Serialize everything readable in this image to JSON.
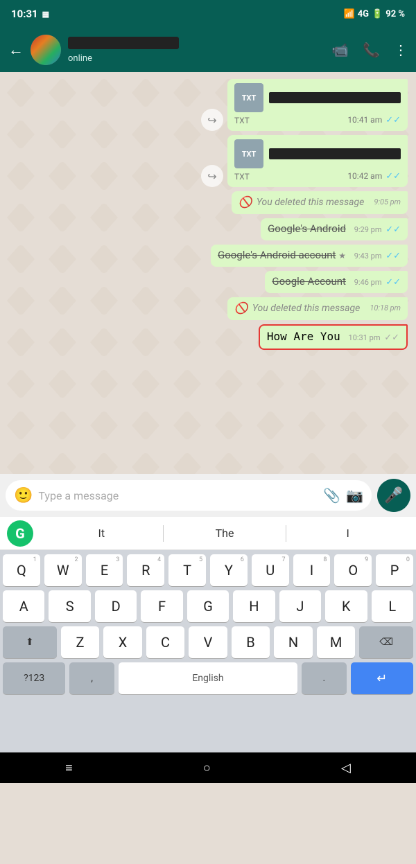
{
  "statusBar": {
    "time": "10:31",
    "signal": "4G",
    "battery": "92 %"
  },
  "header": {
    "status": "online",
    "videoIcon": "📹",
    "phoneIcon": "📞",
    "menuIcon": "⋮"
  },
  "messages": [
    {
      "id": "msg1",
      "type": "sent",
      "hasForward": true,
      "fileType": "TXT",
      "fileName": "redacted",
      "time": "10:41 am",
      "ticks": "blue",
      "deleted": false,
      "strikethrough": false
    },
    {
      "id": "msg2",
      "type": "sent",
      "hasForward": true,
      "fileType": "TXT",
      "fileName": "redacted",
      "time": "10:42 am",
      "ticks": "blue",
      "deleted": false,
      "strikethrough": false
    },
    {
      "id": "msg3",
      "type": "sent",
      "hasForward": false,
      "text": "You deleted this message",
      "time": "9:05 pm",
      "deleted": true,
      "ticks": null,
      "strikethrough": false
    },
    {
      "id": "msg4",
      "type": "sent",
      "hasForward": false,
      "text": "Google's Android",
      "time": "9:29 pm",
      "ticks": "blue",
      "deleted": false,
      "strikethrough": true
    },
    {
      "id": "msg5",
      "type": "sent",
      "hasForward": false,
      "text": "Google's Android account",
      "time": "9:43 pm",
      "ticks": "blue",
      "deleted": false,
      "strikethrough": true,
      "hasStar": true
    },
    {
      "id": "msg6",
      "type": "sent",
      "hasForward": false,
      "text": "Google Account",
      "time": "9:46 pm",
      "ticks": "blue",
      "deleted": false,
      "strikethrough": true
    },
    {
      "id": "msg7",
      "type": "sent",
      "hasForward": false,
      "text": "You deleted this message",
      "time": "10:18 pm",
      "deleted": true,
      "ticks": null,
      "strikethrough": false
    },
    {
      "id": "msg8",
      "type": "sent",
      "hasForward": false,
      "text": "How Are You",
      "time": "10:31 pm",
      "ticks": "grey",
      "deleted": false,
      "strikethrough": false,
      "highlighted": true,
      "monospace": true
    }
  ],
  "inputBar": {
    "placeholder": "Type a message"
  },
  "keyboard": {
    "suggestions": [
      "It",
      "The",
      "I"
    ],
    "rows": [
      [
        "Q",
        "W",
        "E",
        "R",
        "T",
        "Y",
        "U",
        "I",
        "O",
        "P"
      ],
      [
        "A",
        "S",
        "D",
        "F",
        "G",
        "H",
        "J",
        "K",
        "L"
      ],
      [
        "Z",
        "X",
        "C",
        "V",
        "B",
        "N",
        "M"
      ]
    ],
    "numbers": [
      "1",
      "2",
      "3",
      "4",
      "5",
      "6",
      "7",
      "8",
      "9",
      "0"
    ],
    "spaceLabel": "English",
    "numLabel": "?123",
    "commaLabel": ",",
    "periodLabel": "."
  },
  "bottomNav": {
    "menuIcon": "≡",
    "homeIcon": "○",
    "backIcon": "◁"
  }
}
